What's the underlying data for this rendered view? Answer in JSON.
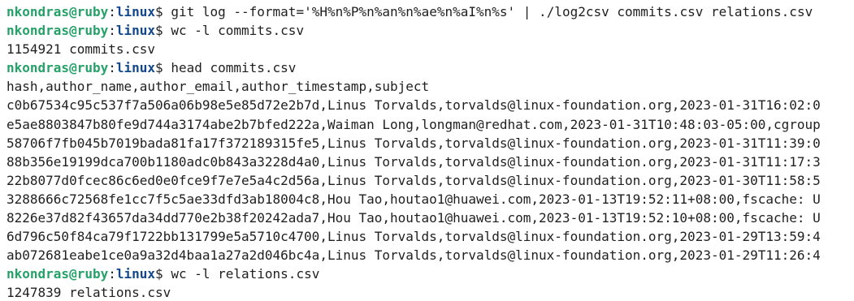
{
  "prompt": {
    "user_host": "nkondras@ruby",
    "sep": ":",
    "cwd": "linux",
    "symbol": "$ "
  },
  "lines": [
    {
      "type": "prompt",
      "text": "git log --format='%H%n%P%n%an%n%ae%n%aI%n%s' | ./log2csv commits.csv relations.csv"
    },
    {
      "type": "prompt",
      "text": "wc -l commits.csv"
    },
    {
      "type": "output",
      "text": "1154921 commits.csv"
    },
    {
      "type": "prompt",
      "text": "head commits.csv"
    },
    {
      "type": "output",
      "text": "hash,author_name,author_email,author_timestamp,subject"
    },
    {
      "type": "output",
      "text": "c0b67534c95c537f7a506a06b98e5e85d72e2b7d,Linus Torvalds,torvalds@linux-foundation.org,2023-01-31T16:02:0"
    },
    {
      "type": "output",
      "text": "e5ae8803847b80fe9d744a3174abe2b7bfed222a,Waiman Long,longman@redhat.com,2023-01-31T10:48:03-05:00,cgroup"
    },
    {
      "type": "output",
      "text": "58706f7fb045b7019bada81fa17f372189315fe5,Linus Torvalds,torvalds@linux-foundation.org,2023-01-31T11:39:0"
    },
    {
      "type": "output",
      "text": "88b356e19199dca700b1180adc0b843a3228d4a0,Linus Torvalds,torvalds@linux-foundation.org,2023-01-31T11:17:3"
    },
    {
      "type": "output",
      "text": "22b8077d0fcec86c6ed0e0fce9f7e7e5a4c2d56a,Linus Torvalds,torvalds@linux-foundation.org,2023-01-30T11:58:5"
    },
    {
      "type": "output",
      "text": "3288666c72568fe1cc7f5c5ae33dfd3ab18004c8,Hou Tao,houtao1@huawei.com,2023-01-13T19:52:11+08:00,fscache: U"
    },
    {
      "type": "output",
      "text": "8226e37d82f43657da34dd770e2b38f20242ada7,Hou Tao,houtao1@huawei.com,2023-01-13T19:52:10+08:00,fscache: U"
    },
    {
      "type": "output",
      "text": "6d796c50f84ca79f1722bb131799e5a5710c4700,Linus Torvalds,torvalds@linux-foundation.org,2023-01-29T13:59:4"
    },
    {
      "type": "output",
      "text": "ab072681eabe1ce0a9a32d4baa1a27a2d046bc4a,Linus Torvalds,torvalds@linux-foundation.org,2023-01-29T11:26:4"
    },
    {
      "type": "prompt",
      "text": "wc -l relations.csv"
    },
    {
      "type": "output",
      "text": "1247839 relations.csv"
    }
  ]
}
